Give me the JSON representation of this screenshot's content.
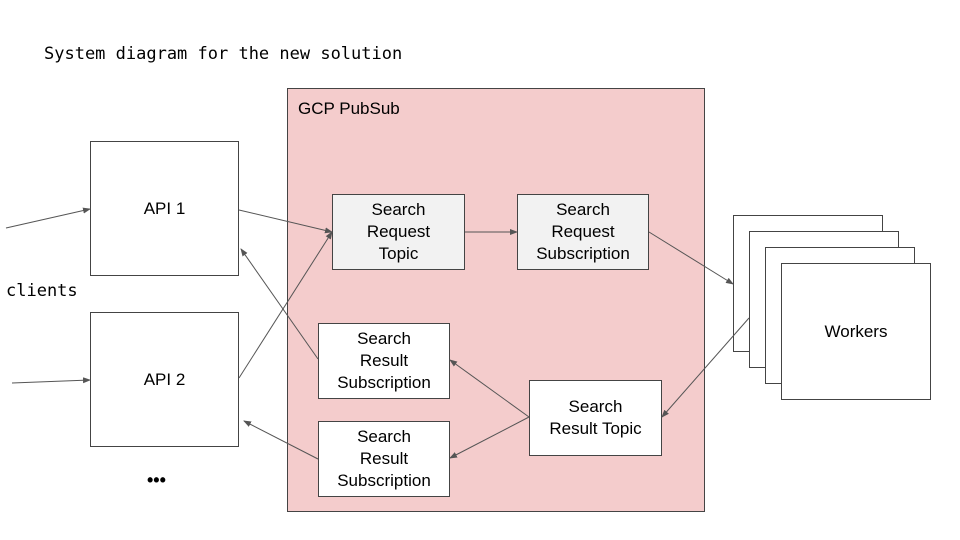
{
  "title": "System diagram for the new solution",
  "clients_label": "clients",
  "ellipsis": "•••",
  "apis": [
    {
      "label": "API 1"
    },
    {
      "label": "API 2"
    }
  ],
  "pubsub": {
    "label": "GCP PubSub",
    "fill_color": "#f4cccc",
    "request_topic": "Search Request Topic",
    "request_topic_lines": [
      "Search",
      "Request",
      "Topic"
    ],
    "request_subscription_lines": [
      "Search",
      "Request",
      "Subscription"
    ],
    "result_subscription_1_lines": [
      "Search",
      "Result",
      "Subscription"
    ],
    "result_subscription_2_lines": [
      "Search",
      "Result",
      "Subscription"
    ],
    "result_topic_lines": [
      "Search",
      "Result Topic"
    ]
  },
  "workers": {
    "label": "Workers",
    "stack_count": 4
  }
}
